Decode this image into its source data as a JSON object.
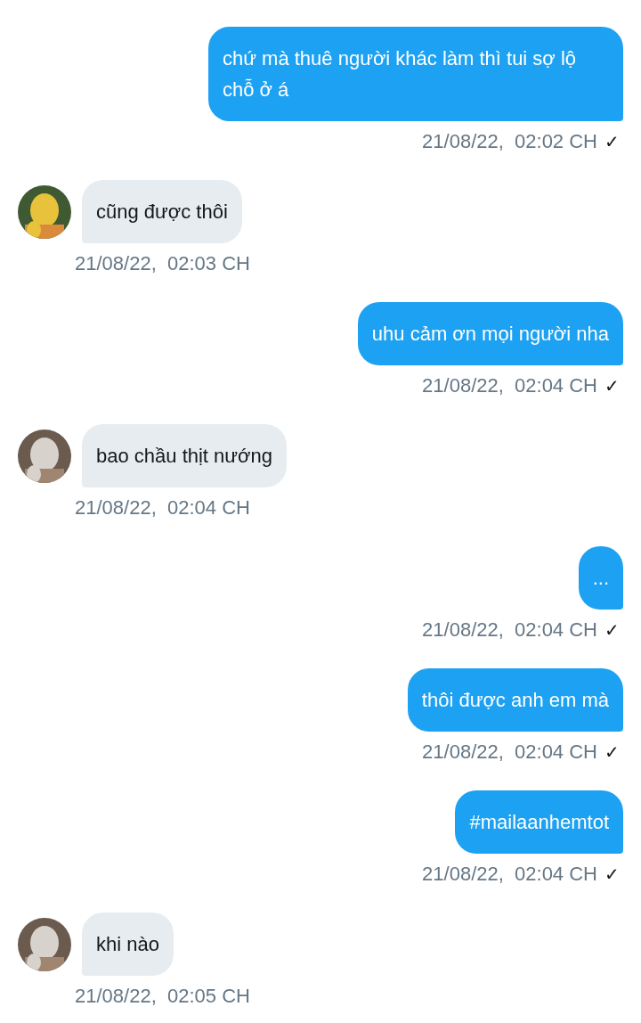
{
  "messages": [
    {
      "kind": "sent",
      "text": "chứ mà thuê người khác làm thì tui sợ lộ chỗ ở á",
      "time": "21/08/22,  02:02 CH",
      "status": "✓"
    },
    {
      "kind": "received",
      "text": "cũng được thôi",
      "time": "21/08/22,  02:03 CH"
    },
    {
      "kind": "sent",
      "text": "uhu cảm ơn mọi người nha",
      "time": "21/08/22,  02:04 CH",
      "status": "✓"
    },
    {
      "kind": "received",
      "text": "bao chầu thịt nướng",
      "time": "21/08/22,  02:04 CH"
    },
    {
      "kind": "sent",
      "text": "...",
      "time": "21/08/22,  02:04 CH",
      "status": "✓"
    },
    {
      "kind": "sent",
      "text": "thôi được anh em mà",
      "time": "21/08/22,  02:04 CH",
      "status": "✓"
    },
    {
      "kind": "sent",
      "text": "#mailaanhemtot",
      "time": "21/08/22,  02:04 CH",
      "status": "✓"
    },
    {
      "kind": "received",
      "text": "khi nào",
      "time": "21/08/22,  02:05 CH"
    }
  ]
}
